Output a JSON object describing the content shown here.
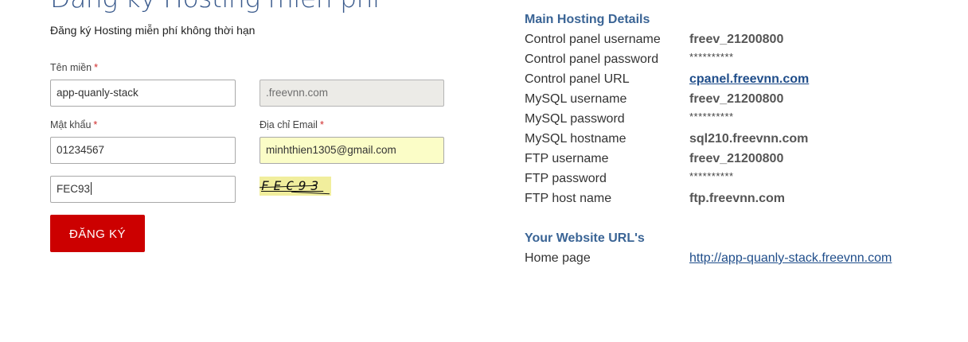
{
  "form": {
    "title": "Đăng ký Hosting miễn phí",
    "subtitle": "Đăng ký Hosting miễn phí không thời hạn",
    "domain_label": "Tên miền",
    "domain_value": "app-quanly-stack",
    "domain_suffix": ".freevnn.com",
    "password_label": "Mật khẩu",
    "password_value": "01234567",
    "email_label": "Địa chỉ Email",
    "email_value": "minhthien1305@gmail.com",
    "captcha_input_value": "FEC93",
    "captcha_text": "FEC93",
    "required_mark": "*",
    "submit_label": "ĐĂNG KÝ"
  },
  "hosting": {
    "title": "Main Hosting Details",
    "rows": [
      {
        "label": "Control panel username",
        "value": "freev_21200800"
      },
      {
        "label": "Control panel password",
        "value": "**********"
      },
      {
        "label": "Control panel URL",
        "value": "cpanel.freevnn.com"
      },
      {
        "label": "MySQL username",
        "value": "freev_21200800"
      },
      {
        "label": "MySQL password",
        "value": "**********"
      },
      {
        "label": "MySQL hostname",
        "value": "sql210.freevnn.com"
      },
      {
        "label": "FTP username",
        "value": "freev_21200800"
      },
      {
        "label": "FTP password",
        "value": "**********"
      },
      {
        "label": "FTP host name",
        "value": "ftp.freevnn.com"
      }
    ]
  },
  "website": {
    "title": "Your Website URL's",
    "home_label": "Home page",
    "home_url": "http://app-quanly-stack.freevnn.com"
  },
  "colors": {
    "title_blue": "#3a5a8c",
    "section_blue": "#3a6495",
    "link_blue": "#1f4d8a",
    "button_red": "#cc0000",
    "autofill_yellow": "#fbfdc7",
    "captcha_yellow": "#f1ee9d"
  }
}
